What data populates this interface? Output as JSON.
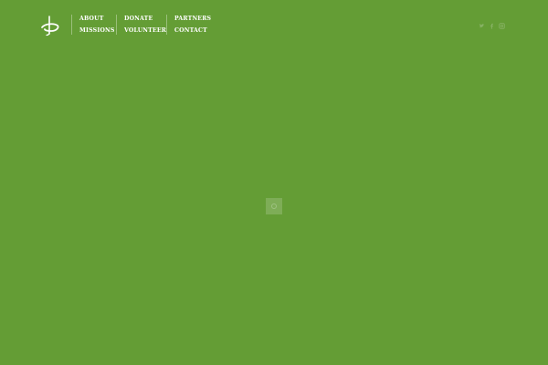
{
  "theme": {
    "background": "#649D35",
    "text": "#FFFFFF",
    "icon_muted": "#86B163"
  },
  "logo": {
    "icon": "stylized-figure-logo-icon"
  },
  "nav": {
    "columns": [
      [
        "ABOUT",
        "MISSIONS"
      ],
      [
        "DONATE",
        "VOLUNTEER"
      ],
      [
        "PARTNERS",
        "CONTACT"
      ]
    ]
  },
  "social": {
    "icons": [
      "twitter-icon",
      "facebook-icon",
      "instagram-icon"
    ]
  },
  "loader": {
    "icon": "loading-spinner-icon"
  }
}
